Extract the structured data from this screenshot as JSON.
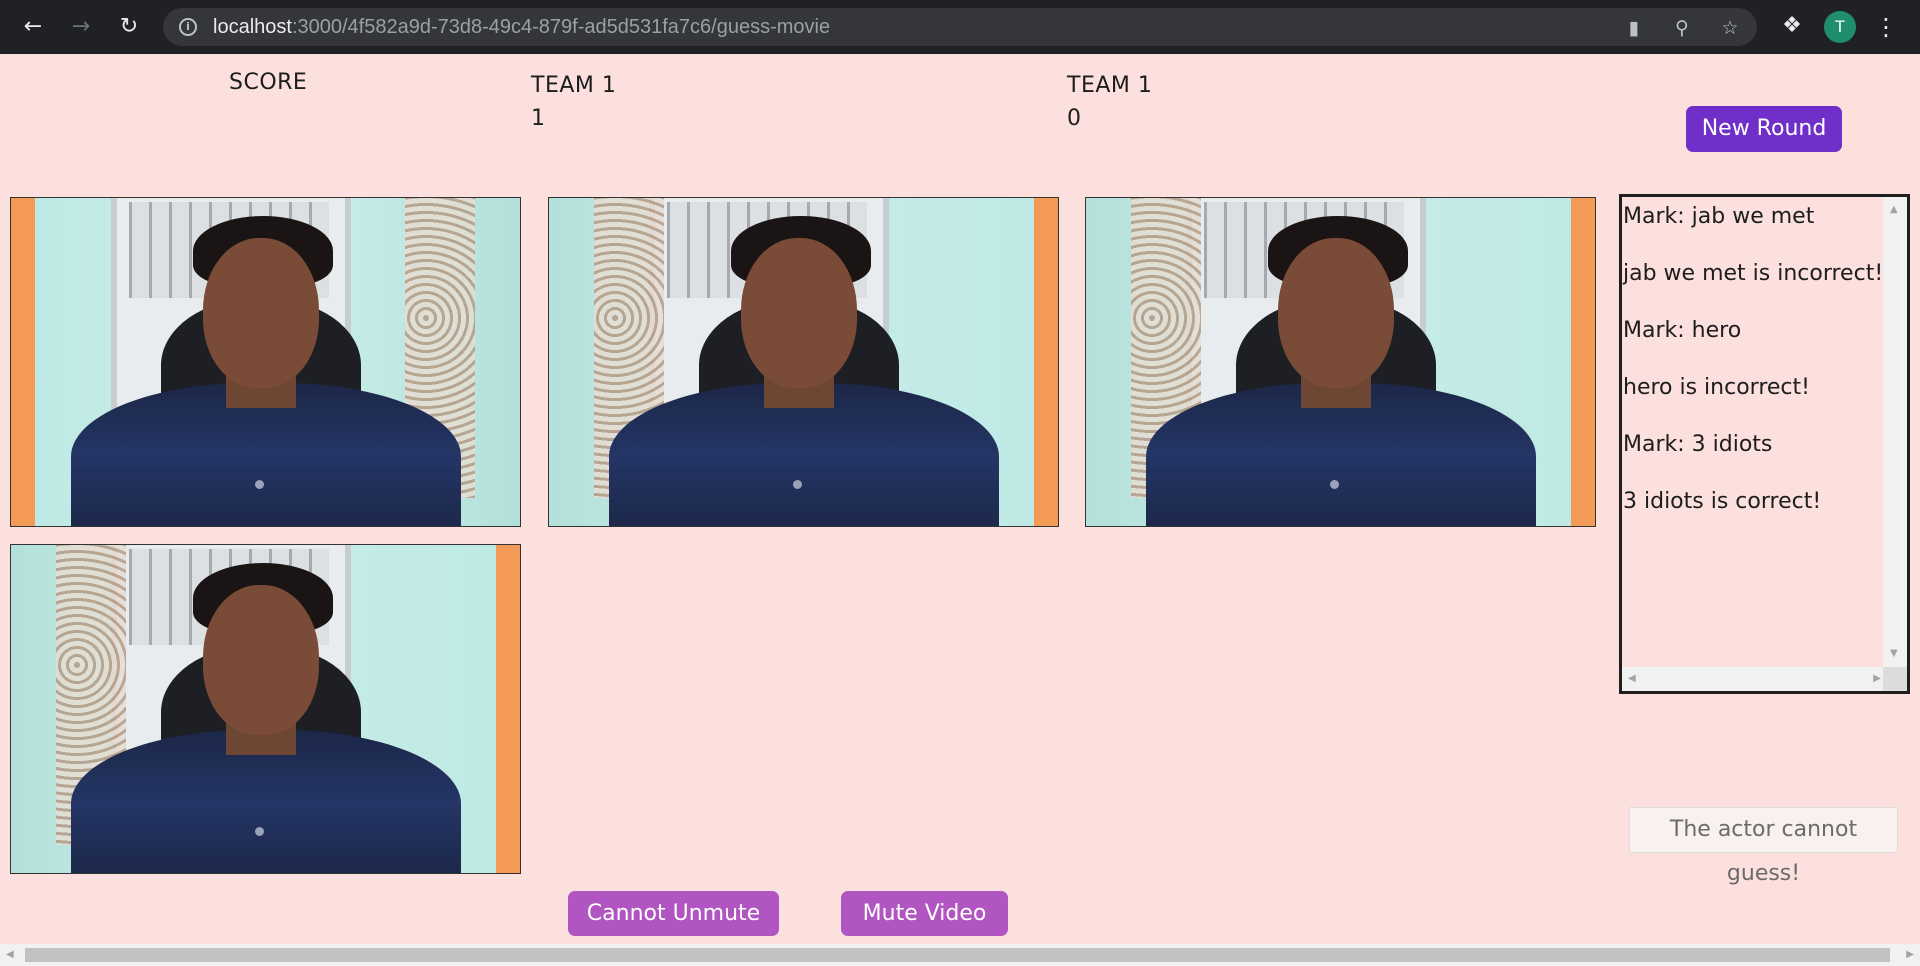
{
  "browser": {
    "url_host": "localhost",
    "url_path": ":3000/4f582a9d-73d8-49c4-879f-ad5d531fa7c6/guess-movie",
    "profile_initial": "T"
  },
  "scoreboard": {
    "label": "SCORE",
    "teams": [
      {
        "name": "TEAM 1",
        "score": "1"
      },
      {
        "name": "TEAM 1",
        "score": "0"
      }
    ]
  },
  "buttons": {
    "new_round": "New Round",
    "unmute": "Cannot Unmute",
    "mute_video": "Mute Video"
  },
  "chat": {
    "messages": [
      "Mark: jab we met",
      "jab we met is incorrect!",
      "Mark: hero",
      "hero is incorrect!",
      "Mark: 3 idiots",
      "3 idiots is correct!"
    ]
  },
  "notice": "The actor cannot guess!",
  "colors": {
    "background": "#fbe0dd",
    "primary_button": "#6f2fc8",
    "secondary_button": "#b055c1"
  },
  "icons": {
    "back": "back-arrow-icon",
    "forward": "forward-arrow-icon",
    "reload": "reload-icon",
    "info": "info-icon",
    "camera": "camera-icon",
    "zoom": "zoom-icon",
    "bookmark": "star-icon",
    "extensions": "puzzle-icon",
    "menu": "kebab-menu-icon"
  }
}
